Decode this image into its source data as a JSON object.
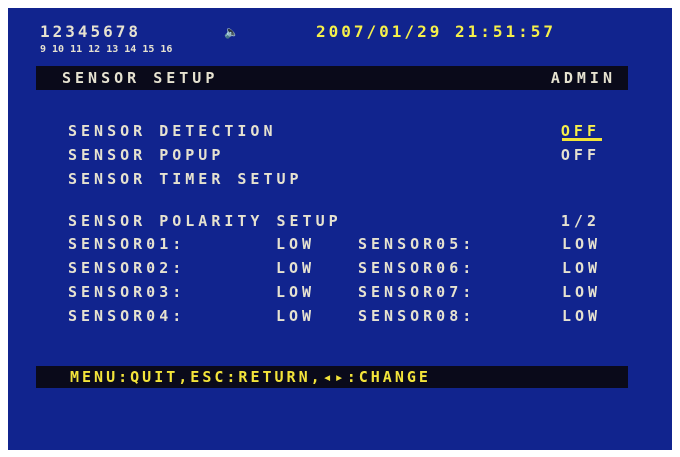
{
  "status": {
    "channels_row1": "12345678",
    "channels_row2": "9 10 11 12 13 14 15 16",
    "speaker_icon": "speaker-icon",
    "datetime": "2007/01/29 21:51:57"
  },
  "header": {
    "title": "SENSOR SETUP",
    "user": "ADMIN"
  },
  "menu": {
    "items": [
      {
        "label": "SENSOR DETECTION",
        "value": "OFF",
        "selected": true
      },
      {
        "label": "SENSOR POPUP",
        "value": "OFF",
        "selected": false
      },
      {
        "label": "SENSOR TIMER SETUP",
        "value": "",
        "selected": false
      }
    ]
  },
  "polarity": {
    "label": "SENSOR POLARITY SETUP",
    "page": "1/2",
    "sensors": [
      {
        "name": "SENSOR01:",
        "value": "LOW"
      },
      {
        "name": "SENSOR02:",
        "value": "LOW"
      },
      {
        "name": "SENSOR03:",
        "value": "LOW"
      },
      {
        "name": "SENSOR04:",
        "value": "LOW"
      },
      {
        "name": "SENSOR05:",
        "value": "LOW"
      },
      {
        "name": "SENSOR06:",
        "value": "LOW"
      },
      {
        "name": "SENSOR07:",
        "value": "LOW"
      },
      {
        "name": "SENSOR08:",
        "value": "LOW"
      }
    ]
  },
  "footer": {
    "help": "MENU:QUIT,ESC:RETURN,◂▸:CHANGE"
  },
  "colors": {
    "background": "#11248e",
    "text": "#e6e2d0",
    "highlight": "#f6f04a",
    "bar": "#0a0a1a"
  }
}
